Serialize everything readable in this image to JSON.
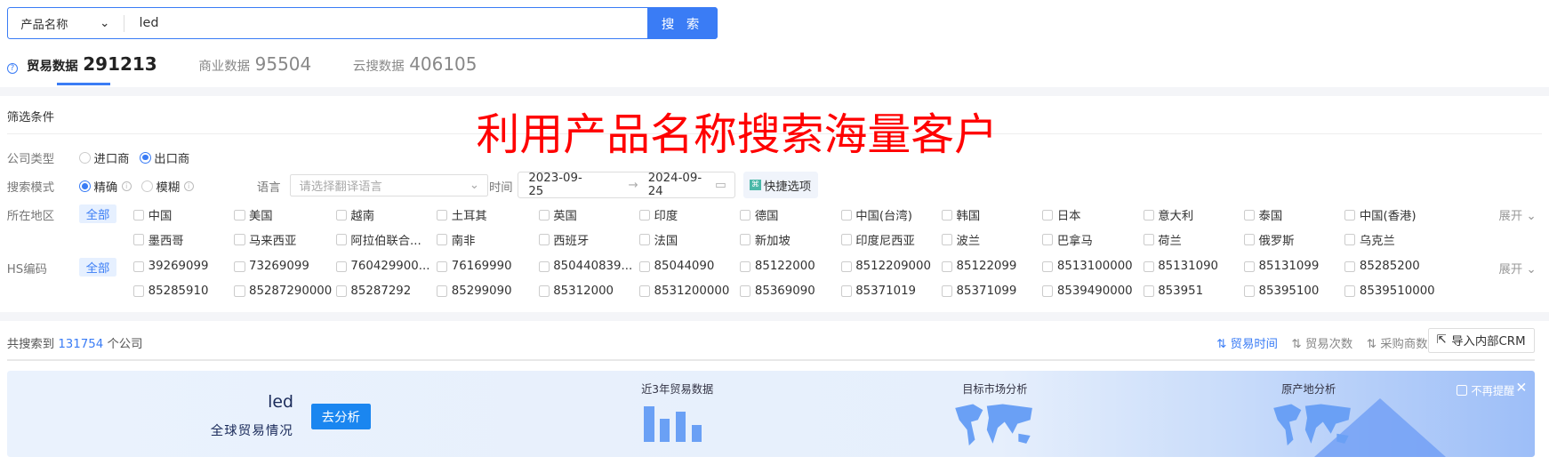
{
  "search": {
    "field": "产品名称",
    "query": "led",
    "button": "搜 索"
  },
  "tabs": [
    {
      "label": "贸易数据",
      "count": "291213"
    },
    {
      "label": "商业数据",
      "count": "95504"
    },
    {
      "label": "云搜数据",
      "count": "406105"
    }
  ],
  "filters": {
    "title": "筛选条件",
    "overlay": "利用产品名称搜索海量客户",
    "company_type": {
      "label": "公司类型",
      "options": [
        "进口商",
        "出口商"
      ],
      "selected": "出口商"
    },
    "search_mode": {
      "label": "搜索模式",
      "options": [
        "精确",
        "模糊"
      ],
      "selected": "精确"
    },
    "language": {
      "label": "语言",
      "placeholder": "请选择翻译语言"
    },
    "time": {
      "label": "时间",
      "start": "2023-09-25",
      "end": "2024-09-24",
      "quick": "快捷选项"
    },
    "region": {
      "label": "所在地区",
      "all": "全部",
      "items": [
        "中国",
        "美国",
        "越南",
        "土耳其",
        "英国",
        "印度",
        "德国",
        "中国(台湾)",
        "韩国",
        "日本",
        "意大利",
        "泰国",
        "中国(香港)",
        "墨西哥",
        "马来西亚",
        "阿拉伯联合...",
        "南非",
        "西班牙",
        "法国",
        "新加坡",
        "印度尼西亚",
        "波兰",
        "巴拿马",
        "荷兰",
        "俄罗斯",
        "乌克兰"
      ],
      "expand": "展开"
    },
    "hs": {
      "label": "HS编码",
      "all": "全部",
      "items": [
        "39269099",
        "73269099",
        "760429900...",
        "76169990",
        "850440839...",
        "85044090",
        "85122000",
        "8512209000",
        "85122099",
        "8513100000",
        "85131090",
        "85131099",
        "85285200",
        "85285910",
        "85287290000",
        "85287292",
        "85299090",
        "85312000",
        "8531200000",
        "85369090",
        "85371019",
        "85371099",
        "8539490000",
        "853951",
        "85395100",
        "8539510000"
      ],
      "expand": "展开"
    }
  },
  "results": {
    "prefix": "共搜索到",
    "count": "131754",
    "suffix": "个公司",
    "sorts": [
      "贸易时间",
      "贸易次数",
      "采购商数"
    ],
    "active_sort": "贸易时间",
    "crm": "导入内部CRM"
  },
  "banner": {
    "keyword": "led",
    "subtitle": "全球贸易情况",
    "analyze": "去分析",
    "sections": [
      "近3年贸易数据",
      "目标市场分析",
      "原产地分析"
    ],
    "no_remind": "不再提醒",
    "accent": "#1a86f0"
  }
}
